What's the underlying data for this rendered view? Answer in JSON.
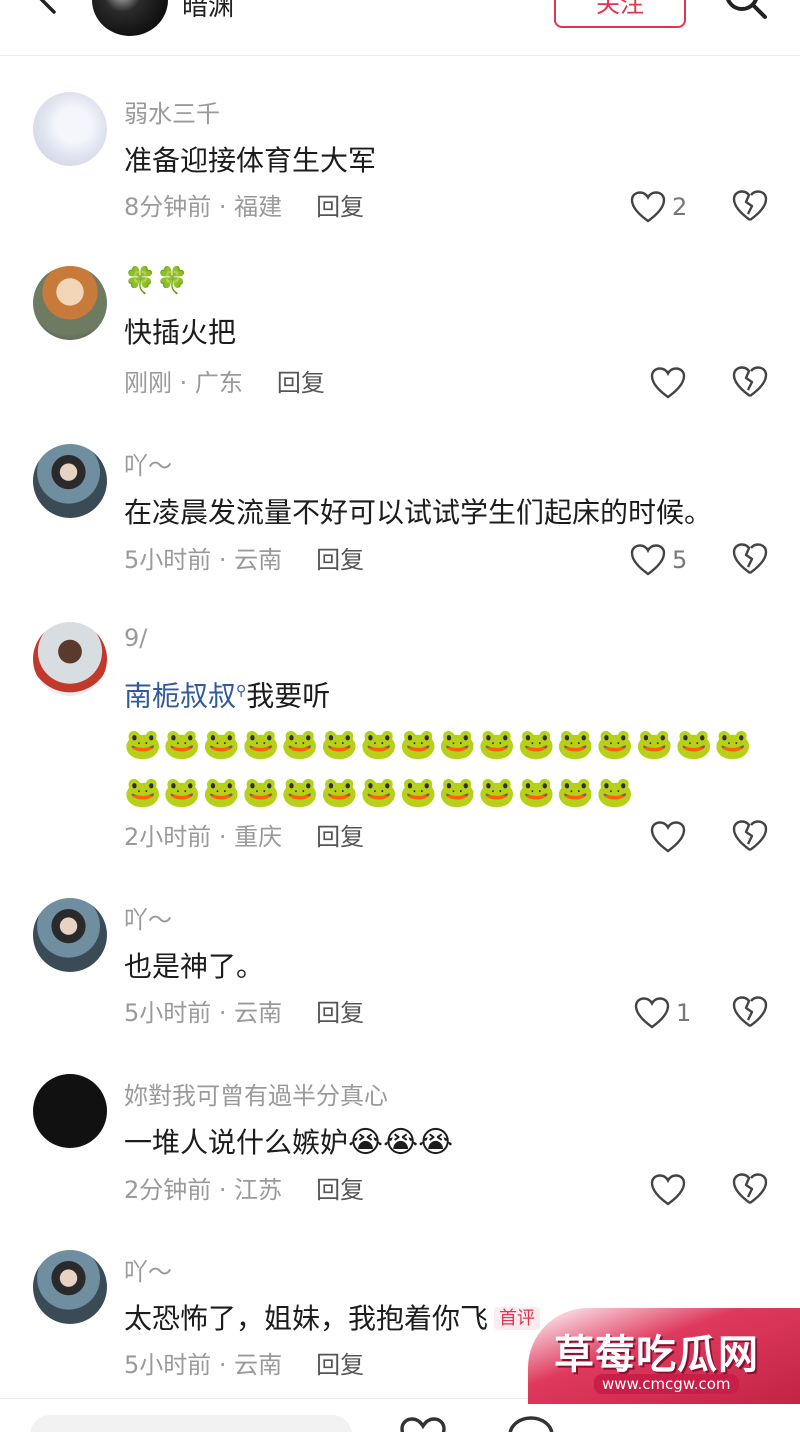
{
  "header": {
    "author_name": "暗渊",
    "follow_label": "关注"
  },
  "comments": [
    {
      "username": "弱水三千",
      "text": "准备迎接体育生大军",
      "time": "8分钟前 · 福建",
      "reply": "回复",
      "likes": "2",
      "avatar_icon": "ghost-avatar"
    },
    {
      "username": "🍀🍀",
      "text": "快插火把",
      "time": "刚刚 · 广东",
      "reply": "回复",
      "likes": "",
      "avatar_icon": "anime-girl-avatar"
    },
    {
      "username": "吖～",
      "text": "在凌晨发流量不好可以试试学生们起床的时候。",
      "time": "5小时前 · 云南",
      "reply": "回复",
      "likes": "5",
      "avatar_icon": "woman-avatar"
    },
    {
      "username": "9/",
      "mention": "南栀叔叔",
      "text": "我要听",
      "emoji": "🐸",
      "emoji_count": 29,
      "time": "2小时前 · 重庆",
      "reply": "回复",
      "likes": "",
      "avatar_icon": "man-avatar"
    },
    {
      "username": "吖～",
      "text": "也是神了。",
      "time": "5小时前 · 云南",
      "reply": "回复",
      "likes": "1",
      "avatar_icon": "woman-avatar"
    },
    {
      "username": "妳對我可曾有過半分真心",
      "text": "一堆人说什么嫉妒",
      "emoji_suffix": "😭😭😭",
      "time": "2分钟前 · 江苏",
      "reply": "回复",
      "likes": "",
      "avatar_icon": "black-avatar"
    },
    {
      "username": "吖～",
      "text": "太恐怖了，姐妹，我抱着你飞",
      "tag": "首评",
      "time": "5小时前 · 云南",
      "reply": "回复",
      "likes": "",
      "avatar_icon": "woman-avatar"
    }
  ],
  "watermark": {
    "title": "草莓吃瓜网",
    "url": "www.cmcgw.com"
  },
  "colors": {
    "accent": "#e2344f",
    "mention": "#2f5a9c",
    "meta": "#9a9a9a"
  }
}
